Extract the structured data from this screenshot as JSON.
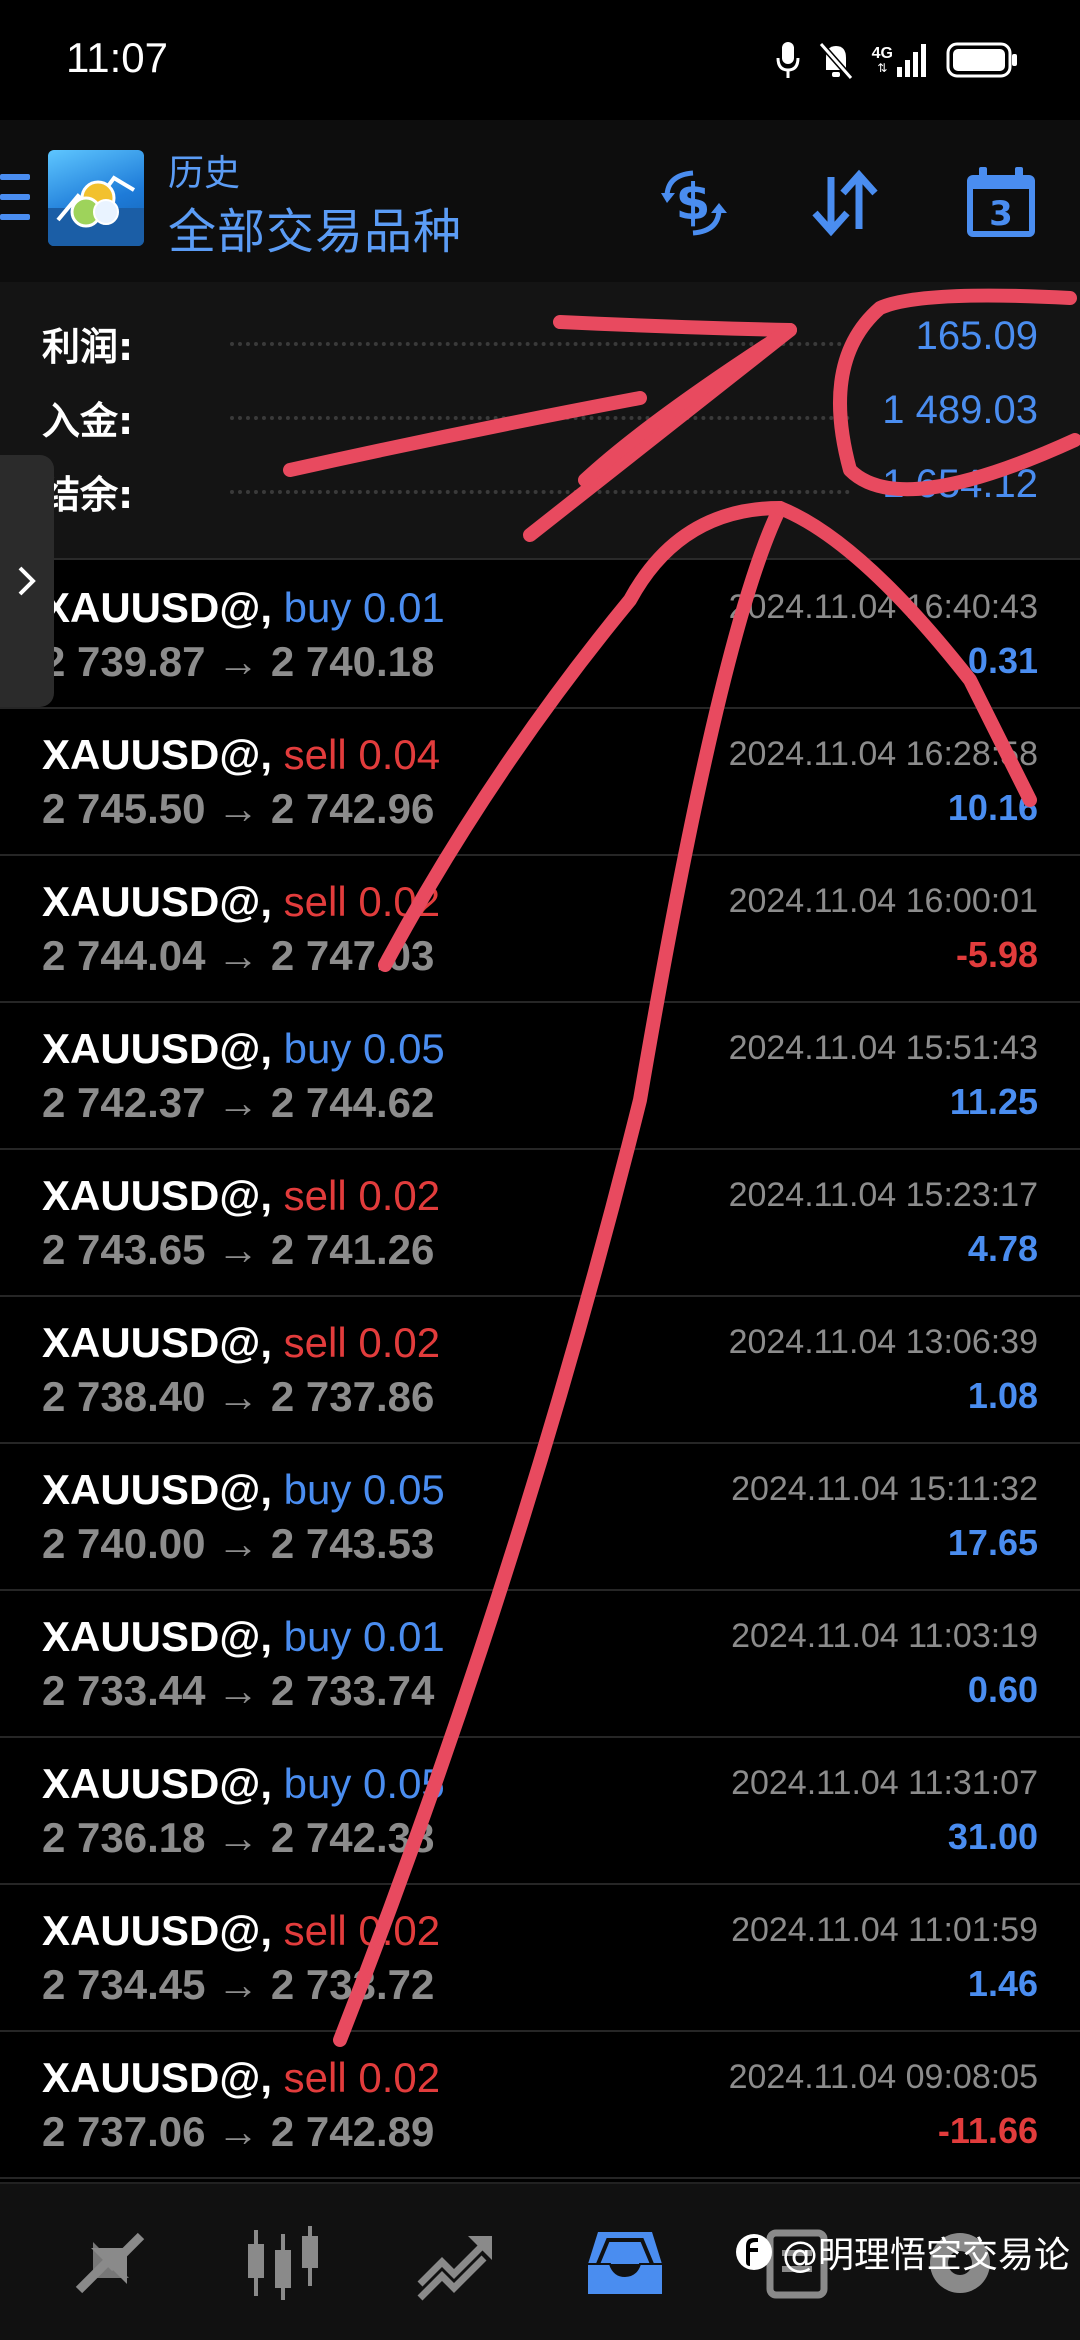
{
  "status_bar": {
    "time": "11:07",
    "network": "4G"
  },
  "header": {
    "subtitle": "历史",
    "title": "全部交易品种"
  },
  "summary": [
    {
      "label": "利润:",
      "value": "165.09"
    },
    {
      "label": "入金:",
      "value": "1 489.03"
    },
    {
      "label": "结余:",
      "value": "1 654.12"
    }
  ],
  "trades": [
    {
      "symbol": "XAUUSD@",
      "sep": ",",
      "type": "buy",
      "volume": "0.01",
      "open": "2 739.87",
      "arrow": "→",
      "close": "2 740.18",
      "time": "2024.11.04 16:40:43",
      "profit": "0.31",
      "sign": "pos"
    },
    {
      "symbol": "XAUUSD@",
      "sep": ",",
      "type": "sell",
      "volume": "0.04",
      "open": "2 745.50",
      "arrow": "→",
      "close": "2 742.96",
      "time": "2024.11.04 16:28:58",
      "profit": "10.16",
      "sign": "pos"
    },
    {
      "symbol": "XAUUSD@",
      "sep": ",",
      "type": "sell",
      "volume": "0.02",
      "open": "2 744.04",
      "arrow": "→",
      "close": "2 747.03",
      "time": "2024.11.04 16:00:01",
      "profit": "-5.98",
      "sign": "neg"
    },
    {
      "symbol": "XAUUSD@",
      "sep": ",",
      "type": "buy",
      "volume": "0.05",
      "open": "2 742.37",
      "arrow": "→",
      "close": "2 744.62",
      "time": "2024.11.04 15:51:43",
      "profit": "11.25",
      "sign": "pos"
    },
    {
      "symbol": "XAUUSD@",
      "sep": ",",
      "type": "sell",
      "volume": "0.02",
      "open": "2 743.65",
      "arrow": "→",
      "close": "2 741.26",
      "time": "2024.11.04 15:23:17",
      "profit": "4.78",
      "sign": "pos"
    },
    {
      "symbol": "XAUUSD@",
      "sep": ",",
      "type": "sell",
      "volume": "0.02",
      "open": "2 738.40",
      "arrow": "→",
      "close": "2 737.86",
      "time": "2024.11.04 13:06:39",
      "profit": "1.08",
      "sign": "pos"
    },
    {
      "symbol": "XAUUSD@",
      "sep": ",",
      "type": "buy",
      "volume": "0.05",
      "open": "2 740.00",
      "arrow": "→",
      "close": "2 743.53",
      "time": "2024.11.04 15:11:32",
      "profit": "17.65",
      "sign": "pos"
    },
    {
      "symbol": "XAUUSD@",
      "sep": ",",
      "type": "buy",
      "volume": "0.01",
      "open": "2 733.44",
      "arrow": "→",
      "close": "2 733.74",
      "time": "2024.11.04 11:03:19",
      "profit": "0.60",
      "sign": "pos"
    },
    {
      "symbol": "XAUUSD@",
      "sep": ",",
      "type": "buy",
      "volume": "0.05",
      "open": "2 736.18",
      "arrow": "→",
      "close": "2 742.38",
      "time": "2024.11.04 11:31:07",
      "profit": "31.00",
      "sign": "pos"
    },
    {
      "symbol": "XAUUSD@",
      "sep": ",",
      "type": "sell",
      "volume": "0.02",
      "open": "2 734.45",
      "arrow": "→",
      "close": "2 733.72",
      "time": "2024.11.04 11:01:59",
      "profit": "1.46",
      "sign": "pos"
    },
    {
      "symbol": "XAUUSD@",
      "sep": ",",
      "type": "sell",
      "volume": "0.02",
      "open": "2 737.06",
      "arrow": "→",
      "close": "2 742.89",
      "time": "2024.11.04 09:08:05",
      "profit": "-11.66",
      "sign": "neg"
    }
  ],
  "bottom_nav": [
    {
      "icon": "quotes-icon"
    },
    {
      "icon": "chart-icon"
    },
    {
      "icon": "trade-icon"
    },
    {
      "icon": "history-icon",
      "active": true
    },
    {
      "icon": "messages-icon"
    },
    {
      "icon": "settings-icon"
    }
  ],
  "watermark": {
    "text": "@明理悟空交易论"
  },
  "colors": {
    "accent": "#4a8df0",
    "sell": "#e23c3c",
    "muted": "#8c8c8c",
    "annotation": "#e84a5f"
  }
}
